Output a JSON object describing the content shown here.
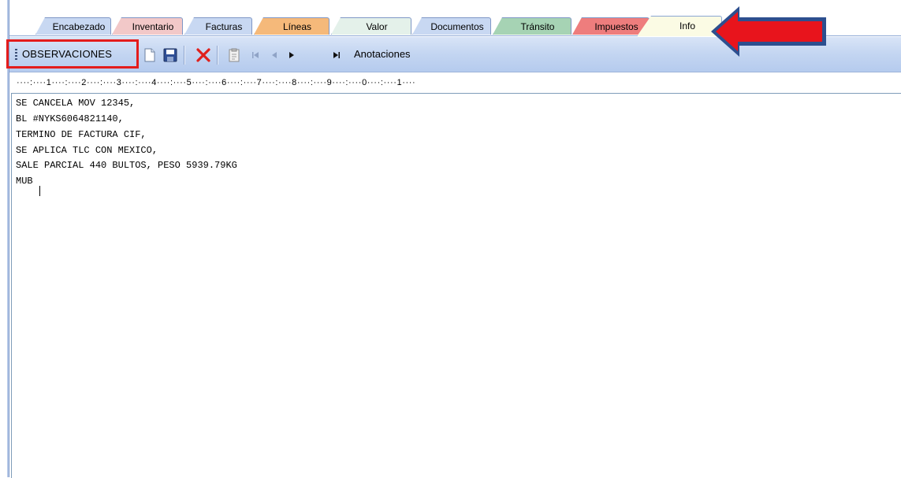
{
  "tabs": [
    {
      "label": "Encabezado",
      "color": "#c8d8f2"
    },
    {
      "label": "Inventario",
      "color": "#f2c8c8"
    },
    {
      "label": "Facturas",
      "color": "#c8d8f2"
    },
    {
      "label": "Líneas",
      "color": "#f5b97a"
    },
    {
      "label": "Valor",
      "color": "#e4f1ea"
    },
    {
      "label": "Documentos",
      "color": "#c8d8f2"
    },
    {
      "label": "Tránsito",
      "color": "#a6d3b4"
    },
    {
      "label": "Impuestos",
      "color": "#ee7d7d"
    },
    {
      "label": "Info",
      "color": "#fbfbe4",
      "active": true
    }
  ],
  "toolbar": {
    "title": "OBSERVACIONES",
    "annotations_label": "Anotaciones",
    "buttons": [
      "new-document-icon",
      "save-icon",
      "delete-icon",
      "clipboard-icon",
      "first-record-icon",
      "previous-record-icon",
      "next-record-icon",
      "last-record-icon"
    ]
  },
  "ruler": {
    "text": "····:····1····:····2····:····3····:····4····:····5····:····6····:····7····:····8····:····9····:····0····:····1····"
  },
  "editor": {
    "lines": [
      "SE CANCELA MOV 12345,",
      "BL #NYKS6064821140,",
      "TERMINO DE FACTURA CIF,",
      "SE APLICA TLC CON MEXICO,",
      "SALE PARCIAL 440 BULTOS, PESO 5939.79KG",
      "MUB"
    ]
  },
  "colors": {
    "toolbar_bg": "#c3d5f1",
    "highlight_box": "#e41c1c",
    "arrow_fill": "#e8141c",
    "arrow_border": "#2d4f8f"
  }
}
